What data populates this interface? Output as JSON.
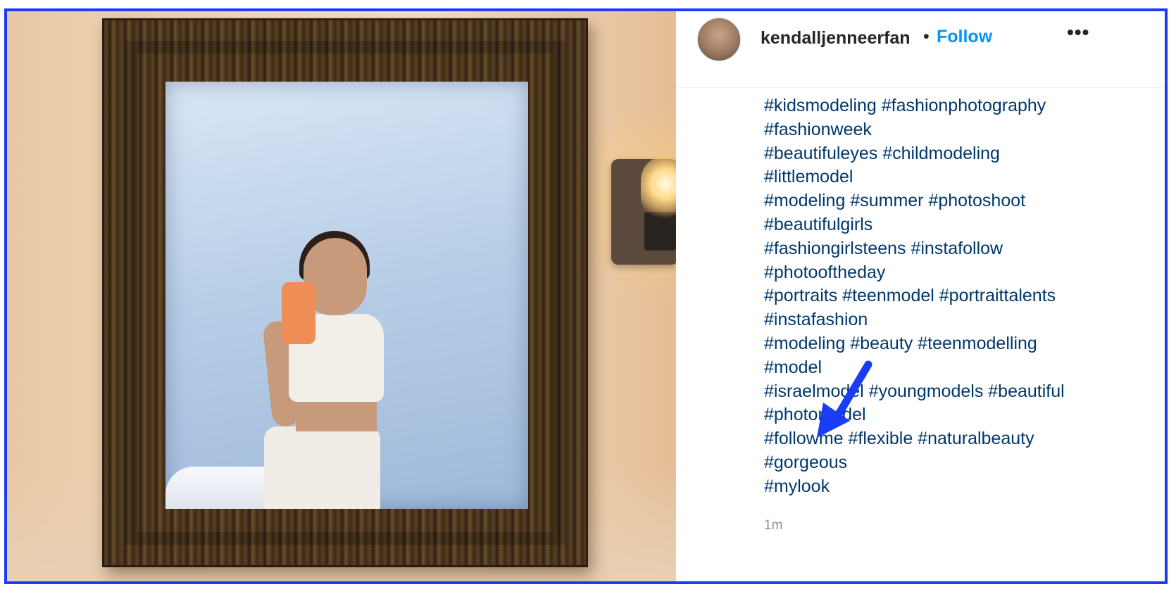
{
  "post": {
    "username": "kendalljenneerfan",
    "separator": "•",
    "follow_label": "Follow",
    "more_label": "•••",
    "timestamp": "1m"
  },
  "caption_lines": [
    [
      "#kidsmodeling",
      "#fashionphotography"
    ],
    [
      "#fashionweek"
    ],
    [
      "#beautifuleyes",
      "#childmodeling"
    ],
    [
      "#littlemodel"
    ],
    [
      "#modeling",
      "#summer",
      "#photoshoot"
    ],
    [
      "#beautifulgirls"
    ],
    [
      "#fashiongirlsteens",
      "#instafollow"
    ],
    [
      "#photooftheday"
    ],
    [
      "#portraits",
      "#teenmodel",
      "#portraittalents"
    ],
    [
      "#instafashion"
    ],
    [
      "#modeling",
      "#beauty",
      "#teenmodelling"
    ],
    [
      "#model"
    ],
    [
      "#israelmodel",
      "#youngmodels",
      "#beautiful"
    ],
    [
      "#photomodel"
    ],
    [
      "#followme",
      "#flexible",
      "#naturalbeauty"
    ],
    [
      "#gorgeous"
    ],
    [
      "#mylook"
    ]
  ],
  "colors": {
    "highlight_border": "#1a3cf5",
    "follow": "#0095f6",
    "hashtag": "#00376b",
    "annotation_arrow": "#1a3cf5"
  },
  "icons": {
    "more": "more-options-icon",
    "annotation": "arrow-annotation-icon"
  }
}
